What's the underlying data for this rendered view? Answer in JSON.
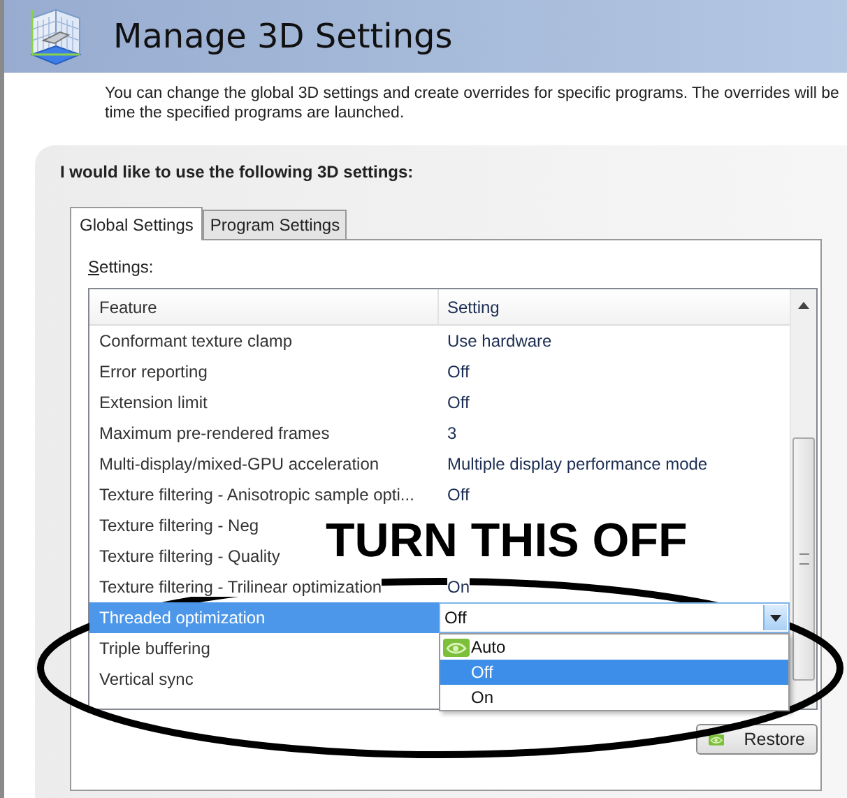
{
  "header": {
    "title": "Manage 3D Settings"
  },
  "description": "You can change the global 3D settings and create overrides for specific programs. The overrides will be time the specified programs are launched.",
  "panel": {
    "heading": "I would like to use the following 3D settings:",
    "tabs": [
      {
        "label": "Global Settings",
        "selected": true
      },
      {
        "label": "Program Settings",
        "selected": false
      }
    ],
    "settings_label": "Settings:",
    "table": {
      "columns": [
        "Feature",
        "Setting"
      ],
      "rows": [
        {
          "feature": "Conformant texture clamp",
          "setting": "Use hardware",
          "selected": false
        },
        {
          "feature": "Error reporting",
          "setting": "Off",
          "selected": false
        },
        {
          "feature": "Extension limit",
          "setting": "Off",
          "selected": false
        },
        {
          "feature": "Maximum pre-rendered frames",
          "setting": "3",
          "selected": false
        },
        {
          "feature": "Multi-display/mixed-GPU acceleration",
          "setting": "Multiple display performance mode",
          "selected": false
        },
        {
          "feature": "Texture filtering - Anisotropic sample opti...",
          "setting": "Off",
          "selected": false
        },
        {
          "feature": "Texture filtering - Neg",
          "selected": false
        },
        {
          "feature": "Texture filtering - Quality",
          "selected": false
        },
        {
          "feature": "Texture filtering - Trilinear optimization",
          "setting": "On",
          "selected": false
        },
        {
          "feature": "Threaded optimization",
          "setting": "Off",
          "selected": true
        },
        {
          "feature": "Triple buffering",
          "selected": false
        },
        {
          "feature": "Vertical sync",
          "selected": false
        }
      ],
      "dropdown": {
        "expanded": true,
        "options": [
          {
            "label": "Auto",
            "selected": false,
            "recommended": true
          },
          {
            "label": "Off",
            "selected": true,
            "recommended": false
          },
          {
            "label": "On",
            "selected": false,
            "recommended": false
          }
        ]
      }
    },
    "restore_button": "Restore"
  },
  "annotation": {
    "text": "TURN THIS OFF"
  }
}
